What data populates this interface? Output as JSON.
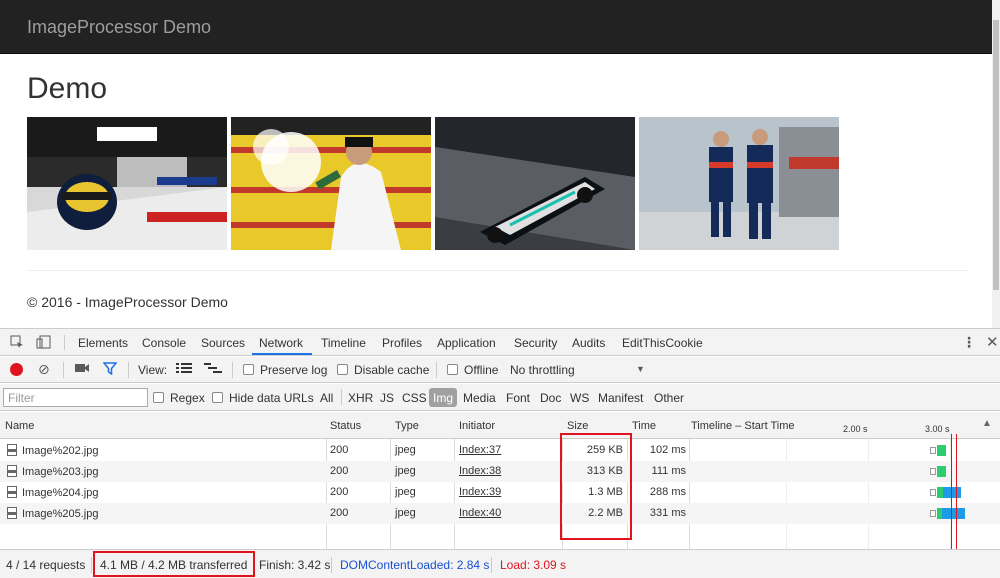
{
  "page": {
    "brand": "ImageProcessor Demo",
    "title": "Demo",
    "footer": "© 2016 - ImageProcessor Demo"
  },
  "devtools": {
    "tabs": [
      "Elements",
      "Console",
      "Sources",
      "Network",
      "Timeline",
      "Profiles",
      "Application",
      "Security",
      "Audits",
      "EditThisCookie"
    ],
    "active_tab": "Network",
    "toolbar": {
      "view_label": "View:",
      "preserve_log": "Preserve log",
      "disable_cache": "Disable cache",
      "offline": "Offline",
      "throttling": "No throttling"
    },
    "filter": {
      "placeholder": "Filter",
      "regex": "Regex",
      "hide_data_urls": "Hide data URLs",
      "types": [
        "All",
        "XHR",
        "JS",
        "CSS",
        "Img",
        "Media",
        "Font",
        "Doc",
        "WS",
        "Manifest",
        "Other"
      ],
      "active_type": "Img"
    },
    "columns": {
      "name": "Name",
      "status": "Status",
      "type": "Type",
      "initiator": "Initiator",
      "size": "Size",
      "time": "Time",
      "timeline": "Timeline – Start Time",
      "tick_200": "2.00 s",
      "tick_300": "3.00 s"
    },
    "rows": [
      {
        "name": "Image%202.jpg",
        "status": "200",
        "type": "jpeg",
        "initiator": "Index:37",
        "size": "259 KB",
        "time": "102 ms"
      },
      {
        "name": "Image%203.jpg",
        "status": "200",
        "type": "jpeg",
        "initiator": "Index:38",
        "size": "313 KB",
        "time": "111 ms"
      },
      {
        "name": "Image%204.jpg",
        "status": "200",
        "type": "jpeg",
        "initiator": "Index:39",
        "size": "1.3 MB",
        "time": "288 ms"
      },
      {
        "name": "Image%205.jpg",
        "status": "200",
        "type": "jpeg",
        "initiator": "Index:40",
        "size": "2.2 MB",
        "time": "331 ms"
      }
    ],
    "status": {
      "requests": "4 / 14 requests",
      "transferred": "4.1 MB / 4.2 MB transferred",
      "finish": "Finish: 3.42 s",
      "dcl": "DOMContentLoaded: 2.84 s",
      "load": "Load: 3.09 s"
    },
    "colors": {
      "dcl": "#1a4fd6",
      "load": "#e0141e",
      "highlight_box": "#e0141e"
    }
  }
}
